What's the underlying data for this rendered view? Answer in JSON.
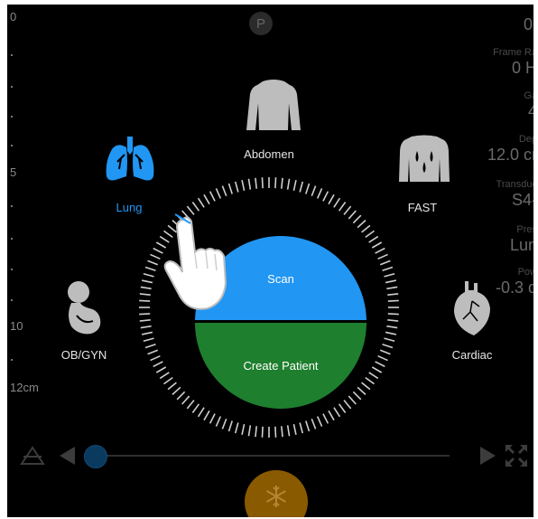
{
  "depth_scale": {
    "top_label": "0",
    "mark_5": "5",
    "mark_10": "10",
    "bottom_label": "12cm"
  },
  "top_center_badge": "P",
  "presets": {
    "abdomen": "Abdomen",
    "lung": "Lung",
    "fast": "FAST",
    "obgyn": "OB/GYN",
    "cardiac": "Cardiac"
  },
  "center_buttons": {
    "scan": "Scan",
    "create_patient": "Create Patient"
  },
  "params": {
    "top_value": "0.",
    "frame_rate_label": "Frame Ra",
    "frame_rate_value": "0 H",
    "gain_label": "Ga",
    "gain_value": "4",
    "depth_label": "Dep",
    "depth_value": "12.0 cr",
    "transducer_label": "Transduc",
    "transducer_value": "S4-",
    "preset_label": "Pres",
    "preset_value": "Lun",
    "power_label": "Pow",
    "power_value": "-0.3 d"
  },
  "slider": {
    "position": 0.0
  },
  "colors": {
    "active_blue": "#2196f3",
    "green": "#1e7f2e",
    "freeze_orange": "#8a5a00"
  },
  "icons": {
    "freeze": "snowflake-icon",
    "fullscreen": "fullscreen-icon",
    "warning": "warning-icon",
    "prev": "triangle-left-icon",
    "next": "triangle-right-icon",
    "hand": "pointing-hand-icon"
  }
}
